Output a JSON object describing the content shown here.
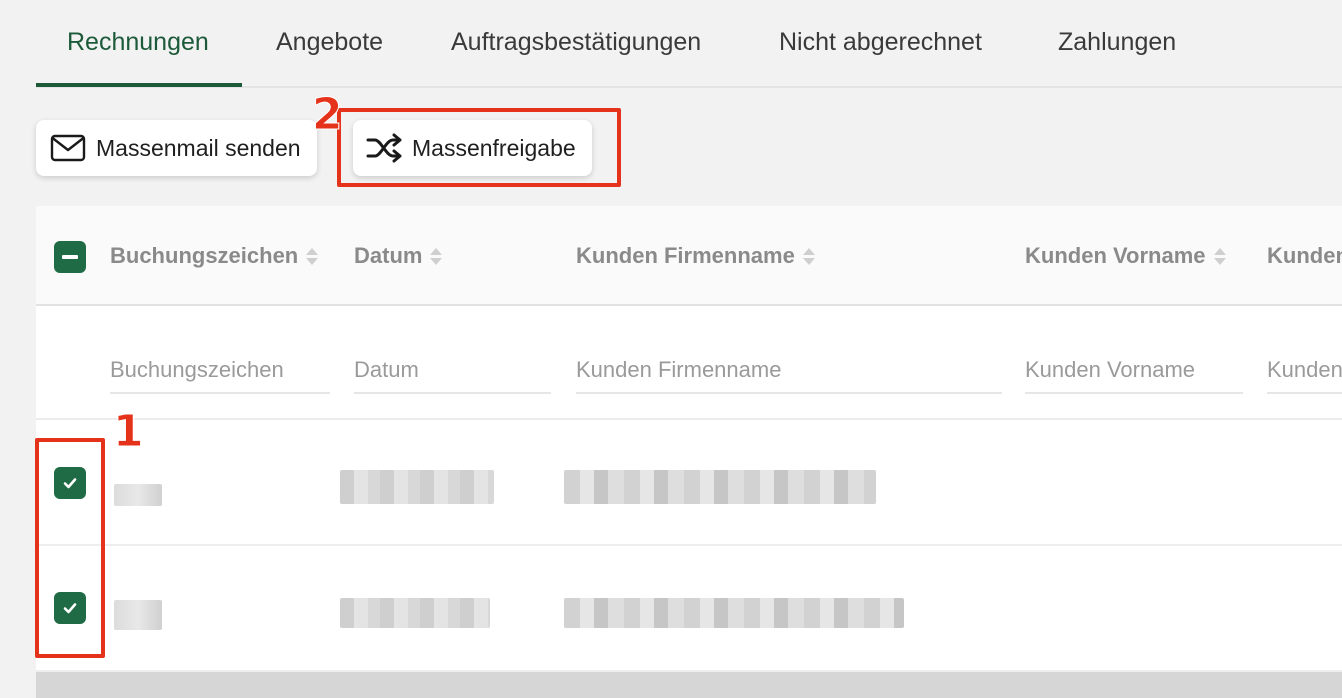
{
  "tabs": [
    {
      "label": "Rechnungen",
      "active": true
    },
    {
      "label": "Angebote",
      "active": false
    },
    {
      "label": "Auftragsbestätigungen",
      "active": false
    },
    {
      "label": "Nicht abgerechnet",
      "active": false
    },
    {
      "label": "Zahlungen",
      "active": false
    }
  ],
  "toolbar": {
    "mass_mail_label": "Massenmail senden",
    "mass_mail_icon": "envelope-icon",
    "mass_release_label": "Massenfreigabe",
    "mass_release_icon": "shuffle-icon"
  },
  "annotations": {
    "checkbox_marker": "1",
    "button_marker": "2",
    "color": "#e5331b"
  },
  "table": {
    "columns": [
      {
        "label": "Buchungszeichen",
        "filter_placeholder": "Buchungszeichen"
      },
      {
        "label": "Datum",
        "filter_placeholder": "Datum"
      },
      {
        "label": "Kunden Firmenname",
        "filter_placeholder": "Kunden Firmenname"
      },
      {
        "label": "Kunden Vorname",
        "filter_placeholder": "Kunden Vorname"
      },
      {
        "label": "Kunden",
        "filter_placeholder": "Kunden"
      }
    ],
    "select_all_state": "indeterminate",
    "rows": [
      {
        "selected": true,
        "redacted": true
      },
      {
        "selected": true,
        "redacted": true
      }
    ]
  },
  "colors": {
    "accent": "#1d5a3a",
    "checkbox": "#1e6b45"
  }
}
